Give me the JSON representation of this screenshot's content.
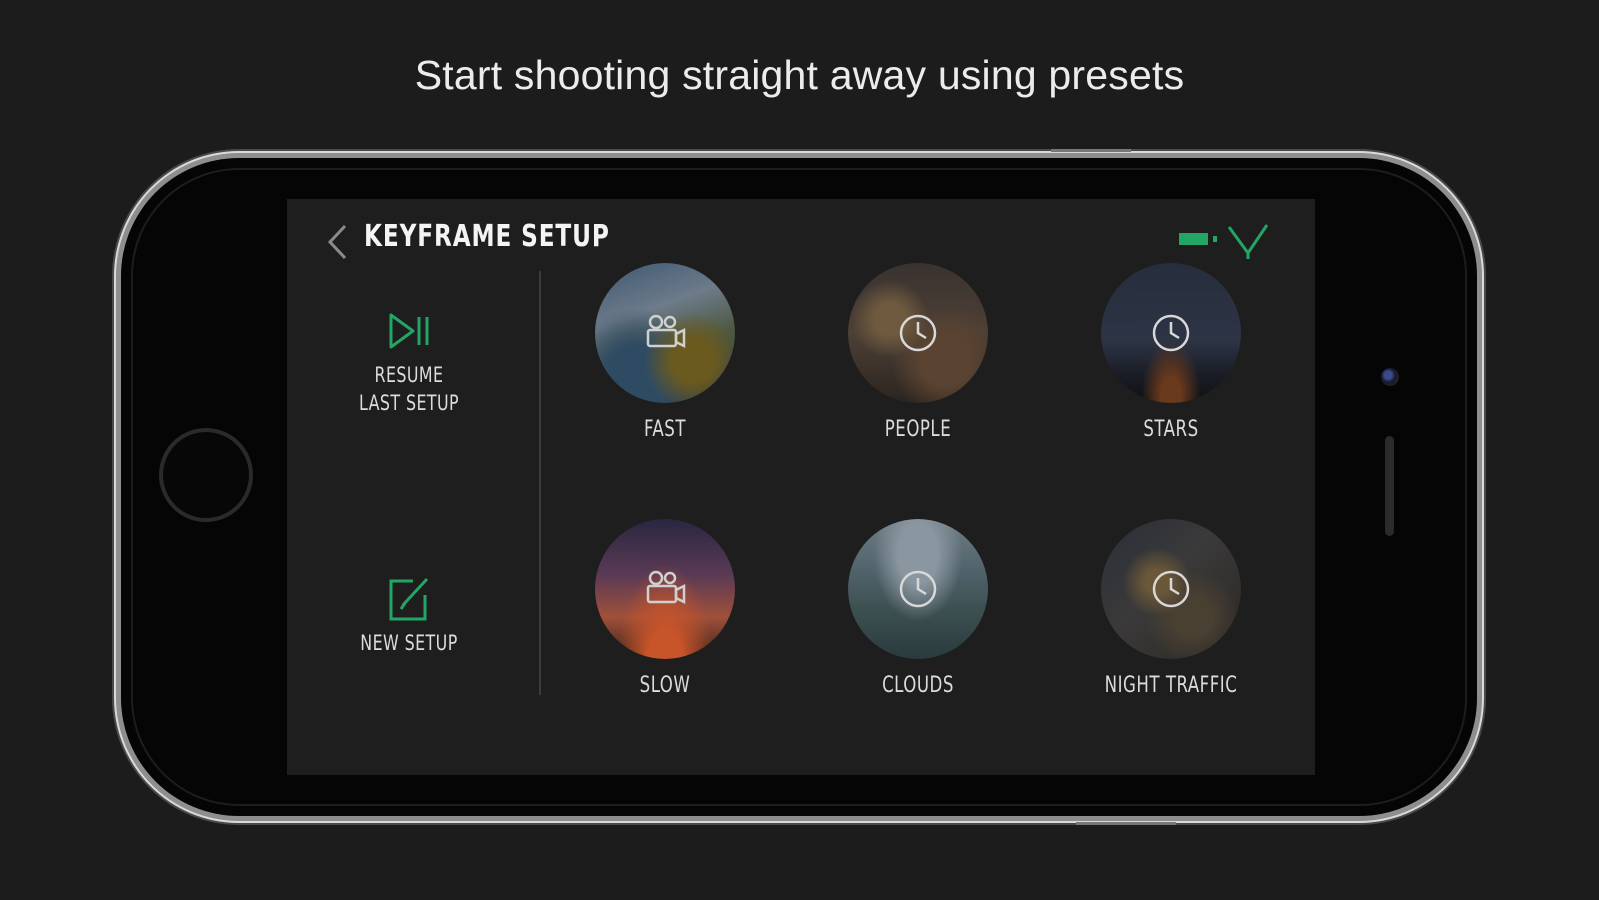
{
  "promo": {
    "headline": "Start shooting straight away using presets"
  },
  "app": {
    "title": "KEYFRAME SETUP",
    "battery_level": 0.85,
    "accent_color": "#22a565"
  },
  "side_actions": [
    {
      "line1": "RESUME",
      "line2": "LAST SETUP",
      "icon": "play-pause-icon"
    },
    {
      "line1": "NEW SETUP",
      "line2": "",
      "icon": "edit-icon"
    }
  ],
  "presets": [
    {
      "label": "FAST",
      "icon": "camera-people-icon"
    },
    {
      "label": "PEOPLE",
      "icon": "clock-icon"
    },
    {
      "label": "STARS",
      "icon": "clock-icon"
    },
    {
      "label": "SLOW",
      "icon": "camera-people-icon"
    },
    {
      "label": "CLOUDS",
      "icon": "clock-icon"
    },
    {
      "label": "NIGHT TRAFFIC",
      "icon": "clock-icon"
    }
  ]
}
